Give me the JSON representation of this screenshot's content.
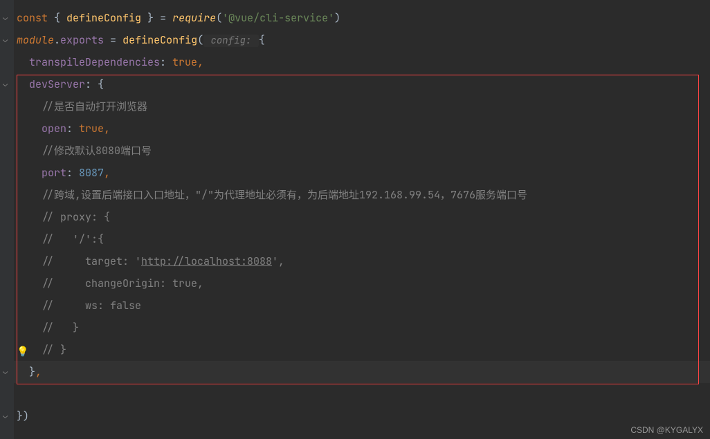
{
  "code": {
    "line1": {
      "const": "const",
      "brace_open": " { ",
      "defineConfig": "defineConfig",
      "brace_close": " } ",
      "eq": "= ",
      "require": "require",
      "paren_open": "(",
      "str": "'@vue/cli-service'",
      "paren_close": ")"
    },
    "line2": {
      "module": "module",
      "dot": ".",
      "exports": "exports",
      "eq": " = ",
      "defineConfig": "defineConfig",
      "paren_open": "(",
      "inlay": " config: ",
      "brace": "{"
    },
    "line3": {
      "indent": "  ",
      "prop": "transpileDependencies",
      "colon": ": ",
      "val": "true",
      "comma": ","
    },
    "line4": {
      "indent": "  ",
      "prop": "devServer",
      "colon": ": ",
      "brace": "{"
    },
    "line5": {
      "indent": "    ",
      "comment": "//是否自动打开浏览器"
    },
    "line6": {
      "indent": "    ",
      "prop": "open",
      "colon": ": ",
      "val": "true",
      "comma": ","
    },
    "line7": {
      "indent": "    ",
      "comment": "//修改默认8080端口号"
    },
    "line8": {
      "indent": "    ",
      "prop": "port",
      "colon": ": ",
      "val": "8087",
      "comma": ","
    },
    "line9": {
      "indent": "    ",
      "comment": "//跨域,设置后端接口入口地址，\"/\"为代理地址必须有，为后端地址192.168.99.54，7676服务端口号"
    },
    "line10": {
      "indent": "    ",
      "comment": "// proxy: {"
    },
    "line11": {
      "indent": "    ",
      "comment": "//   '/':{"
    },
    "line12": {
      "indent": "    ",
      "comment_pre": "//     target: '",
      "comment_url": "http://localhost:8088",
      "comment_post": "',"
    },
    "line13": {
      "indent": "    ",
      "comment": "//     changeOrigin: true,"
    },
    "line14": {
      "indent": "    ",
      "comment": "//     ws: false"
    },
    "line15": {
      "indent": "    ",
      "comment": "//   }"
    },
    "line16": {
      "indent": "    ",
      "comment": "// }"
    },
    "line17": {
      "indent": "  ",
      "brace": "}",
      "comma": ","
    },
    "line18": {
      "spacer": " "
    },
    "line19": {
      "brace": "})"
    }
  },
  "ui": {
    "bulb": "💡",
    "watermark": "CSDN @KYGALYX"
  }
}
